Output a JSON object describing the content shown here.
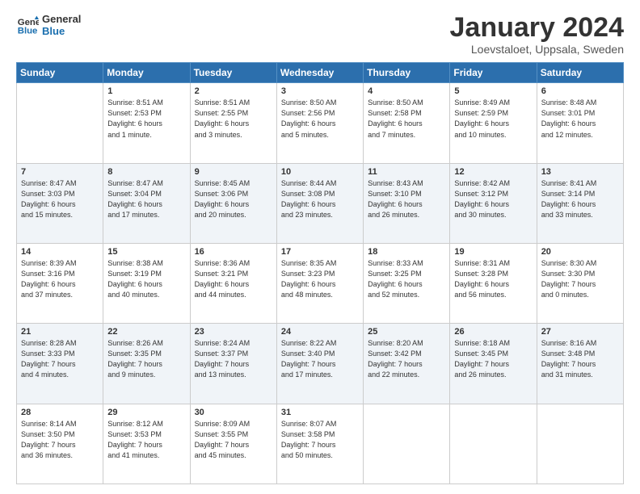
{
  "header": {
    "logo_line1": "General",
    "logo_line2": "Blue",
    "month": "January 2024",
    "location": "Loevstaloet, Uppsala, Sweden"
  },
  "weekdays": [
    "Sunday",
    "Monday",
    "Tuesday",
    "Wednesday",
    "Thursday",
    "Friday",
    "Saturday"
  ],
  "weeks": [
    [
      {
        "day": "",
        "info": ""
      },
      {
        "day": "1",
        "info": "Sunrise: 8:51 AM\nSunset: 2:53 PM\nDaylight: 6 hours\nand 1 minute."
      },
      {
        "day": "2",
        "info": "Sunrise: 8:51 AM\nSunset: 2:55 PM\nDaylight: 6 hours\nand 3 minutes."
      },
      {
        "day": "3",
        "info": "Sunrise: 8:50 AM\nSunset: 2:56 PM\nDaylight: 6 hours\nand 5 minutes."
      },
      {
        "day": "4",
        "info": "Sunrise: 8:50 AM\nSunset: 2:58 PM\nDaylight: 6 hours\nand 7 minutes."
      },
      {
        "day": "5",
        "info": "Sunrise: 8:49 AM\nSunset: 2:59 PM\nDaylight: 6 hours\nand 10 minutes."
      },
      {
        "day": "6",
        "info": "Sunrise: 8:48 AM\nSunset: 3:01 PM\nDaylight: 6 hours\nand 12 minutes."
      }
    ],
    [
      {
        "day": "7",
        "info": "Sunrise: 8:47 AM\nSunset: 3:03 PM\nDaylight: 6 hours\nand 15 minutes."
      },
      {
        "day": "8",
        "info": "Sunrise: 8:47 AM\nSunset: 3:04 PM\nDaylight: 6 hours\nand 17 minutes."
      },
      {
        "day": "9",
        "info": "Sunrise: 8:45 AM\nSunset: 3:06 PM\nDaylight: 6 hours\nand 20 minutes."
      },
      {
        "day": "10",
        "info": "Sunrise: 8:44 AM\nSunset: 3:08 PM\nDaylight: 6 hours\nand 23 minutes."
      },
      {
        "day": "11",
        "info": "Sunrise: 8:43 AM\nSunset: 3:10 PM\nDaylight: 6 hours\nand 26 minutes."
      },
      {
        "day": "12",
        "info": "Sunrise: 8:42 AM\nSunset: 3:12 PM\nDaylight: 6 hours\nand 30 minutes."
      },
      {
        "day": "13",
        "info": "Sunrise: 8:41 AM\nSunset: 3:14 PM\nDaylight: 6 hours\nand 33 minutes."
      }
    ],
    [
      {
        "day": "14",
        "info": "Sunrise: 8:39 AM\nSunset: 3:16 PM\nDaylight: 6 hours\nand 37 minutes."
      },
      {
        "day": "15",
        "info": "Sunrise: 8:38 AM\nSunset: 3:19 PM\nDaylight: 6 hours\nand 40 minutes."
      },
      {
        "day": "16",
        "info": "Sunrise: 8:36 AM\nSunset: 3:21 PM\nDaylight: 6 hours\nand 44 minutes."
      },
      {
        "day": "17",
        "info": "Sunrise: 8:35 AM\nSunset: 3:23 PM\nDaylight: 6 hours\nand 48 minutes."
      },
      {
        "day": "18",
        "info": "Sunrise: 8:33 AM\nSunset: 3:25 PM\nDaylight: 6 hours\nand 52 minutes."
      },
      {
        "day": "19",
        "info": "Sunrise: 8:31 AM\nSunset: 3:28 PM\nDaylight: 6 hours\nand 56 minutes."
      },
      {
        "day": "20",
        "info": "Sunrise: 8:30 AM\nSunset: 3:30 PM\nDaylight: 7 hours\nand 0 minutes."
      }
    ],
    [
      {
        "day": "21",
        "info": "Sunrise: 8:28 AM\nSunset: 3:33 PM\nDaylight: 7 hours\nand 4 minutes."
      },
      {
        "day": "22",
        "info": "Sunrise: 8:26 AM\nSunset: 3:35 PM\nDaylight: 7 hours\nand 9 minutes."
      },
      {
        "day": "23",
        "info": "Sunrise: 8:24 AM\nSunset: 3:37 PM\nDaylight: 7 hours\nand 13 minutes."
      },
      {
        "day": "24",
        "info": "Sunrise: 8:22 AM\nSunset: 3:40 PM\nDaylight: 7 hours\nand 17 minutes."
      },
      {
        "day": "25",
        "info": "Sunrise: 8:20 AM\nSunset: 3:42 PM\nDaylight: 7 hours\nand 22 minutes."
      },
      {
        "day": "26",
        "info": "Sunrise: 8:18 AM\nSunset: 3:45 PM\nDaylight: 7 hours\nand 26 minutes."
      },
      {
        "day": "27",
        "info": "Sunrise: 8:16 AM\nSunset: 3:48 PM\nDaylight: 7 hours\nand 31 minutes."
      }
    ],
    [
      {
        "day": "28",
        "info": "Sunrise: 8:14 AM\nSunset: 3:50 PM\nDaylight: 7 hours\nand 36 minutes."
      },
      {
        "day": "29",
        "info": "Sunrise: 8:12 AM\nSunset: 3:53 PM\nDaylight: 7 hours\nand 41 minutes."
      },
      {
        "day": "30",
        "info": "Sunrise: 8:09 AM\nSunset: 3:55 PM\nDaylight: 7 hours\nand 45 minutes."
      },
      {
        "day": "31",
        "info": "Sunrise: 8:07 AM\nSunset: 3:58 PM\nDaylight: 7 hours\nand 50 minutes."
      },
      {
        "day": "",
        "info": ""
      },
      {
        "day": "",
        "info": ""
      },
      {
        "day": "",
        "info": ""
      }
    ]
  ]
}
